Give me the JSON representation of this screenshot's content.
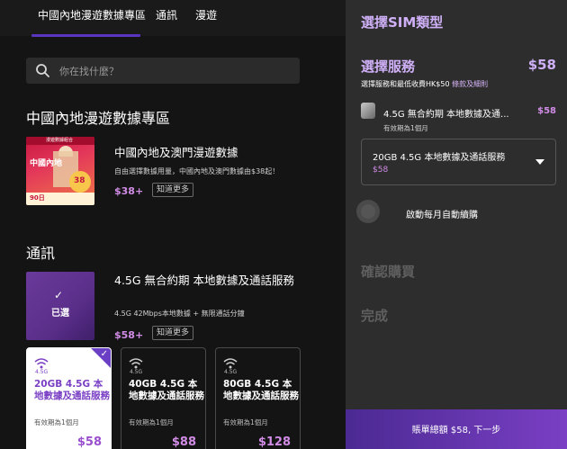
{
  "nav": {
    "tabs": [
      "中國內地漫遊數據專區",
      "通訊",
      "漫遊"
    ],
    "active_index": 0
  },
  "search": {
    "placeholder": "你在找什麼？"
  },
  "section_roaming": {
    "title": "中國內地漫遊數據專區",
    "promo": {
      "image_banner": "漫遊數據組合",
      "image_title": "中國內地",
      "image_badge": "38",
      "image_days": "90日",
      "title": "中國內地及澳門漫遊數據",
      "desc": "自由選擇數據用量，中國內地及澳門數據由$38起！",
      "price": "$38+",
      "learn_more": "知道更多"
    }
  },
  "section_telecom": {
    "title": "通訊",
    "plan": {
      "thumb_label": "已選",
      "title": "4.5G 無合約期 本地數據及通話服務",
      "desc": "4.5G 42Mbps本地數據 + 無限通話分鐘",
      "price": "$58+",
      "learn_more": "知道更多"
    },
    "cards": [
      {
        "tag": "4.5G",
        "name": "20GB 4.5G 本地數據及通話服務",
        "valid": "有效期為1個月",
        "price": "$58",
        "selected": true
      },
      {
        "tag": "4.5G",
        "name": "40GB 4.5G 本地數據及通話服務",
        "valid": "有效期為1個月",
        "price": "$88",
        "selected": false
      },
      {
        "tag": "4.5G",
        "name": "80GB 4.5G 本地數據及通話服務",
        "valid": "有效期為1個月",
        "price": "$128",
        "selected": false
      }
    ]
  },
  "panel": {
    "title": "選擇SIM類型",
    "service_heading": "選擇服務",
    "service_price": "$58",
    "note": "選擇服務和最低收費HK$50",
    "note_link": "條款及細則",
    "selected_plan": "4.5G 無合約期 本地數據及通...",
    "selected_plan_price": "$58",
    "selected_plan_valid": "有效期為1個月",
    "dropdown_value": "20GB 4.5G 本地數據及通話服務",
    "dropdown_price": "$58",
    "auto_renew_label": "啟動每月自動續購",
    "auto_renew_on": false,
    "step_confirm": "確認購買",
    "step_done": "完成",
    "cta": "賬單總額 $58, 下一步"
  },
  "colors": {
    "accent_purple": "#7a3fc4",
    "price_pink": "#d18ce6",
    "heading_lilac": "#cfb0f7",
    "background": "#141414",
    "panel_bg": "#2d2d2d"
  }
}
